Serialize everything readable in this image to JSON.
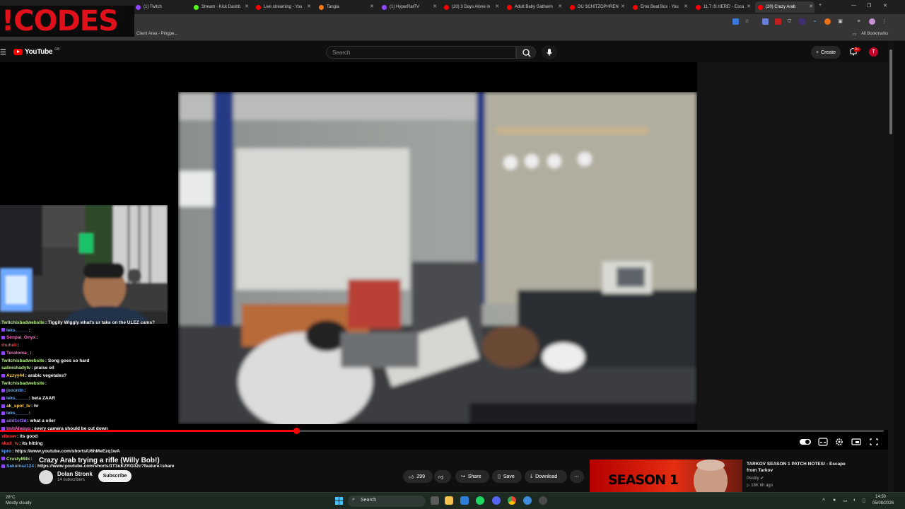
{
  "browser": {
    "tabs": [
      {
        "label": "(1) Twitch",
        "color": "#9147ff"
      },
      {
        "label": "Stream - Kick Dashb",
        "color": "#53fc18"
      },
      {
        "label": "Live streaming - You",
        "color": "#ff0000"
      },
      {
        "label": "Tangia",
        "color": "#ff7a1a"
      },
      {
        "label": "(1) HyperRatTV",
        "color": "#9147ff"
      },
      {
        "label": "(20) 3 Days Alone in",
        "color": "#ff0000"
      },
      {
        "label": "Adult Baby Gatherin",
        "color": "#ff0000"
      },
      {
        "label": "DU SCHITZOPHREN",
        "color": "#ff0000"
      },
      {
        "label": "Emo Beat Box - You",
        "color": "#ff0000"
      },
      {
        "label": "11.7 IS HERE! - Esca",
        "color": "#ff0000"
      },
      {
        "label": "(20) Crazy Arab",
        "color": "#ff0000"
      }
    ],
    "bookmark_client_area": "Client Area - Pingpe...",
    "bookmark_all": "All Bookmarks"
  },
  "overlay": {
    "logo_text": "!CODES"
  },
  "youtube": {
    "logo_text": "YouTube",
    "country_code": "GB",
    "search_placeholder": "Search",
    "create_label": "Create",
    "notification_count": "9+",
    "avatar_letter": "T"
  },
  "player": {
    "progress": 0.335
  },
  "chat": [
    {
      "user": "Twitchisbadwebsite",
      "user_color": "#b9f18a",
      "msg": ": Tiggily Wiggly what's ur take on the ULEZ cams?"
    },
    {
      "user": "leks_____",
      "user_color": "#5fb0ff",
      "msg": ":"
    },
    {
      "user": "Senpai_Onyx",
      "user_color": "#ff6ec7",
      "msg": ":"
    },
    {
      "user": "rhuheli",
      "user_color": "#ff4040",
      "msg": ":"
    },
    {
      "user": "Teratoma_",
      "user_color": "#ff6ec7",
      "msg": ":"
    },
    {
      "user": "Twitchisbadwebsite",
      "user_color": "#b9f18a",
      "msg": ": Song goes so hard"
    },
    {
      "user": "salimshadytv",
      "user_color": "#b9f18a",
      "msg": ": praise oil"
    },
    {
      "user": "Azzyy44",
      "user_color": "#ffd23f",
      "msg": ": arabic vegetales?"
    },
    {
      "user": "Twitchisbadwebsite",
      "user_color": "#b9f18a",
      "msg": ":"
    },
    {
      "user": "jooordn",
      "user_color": "#5fb0ff",
      "msg": ":"
    },
    {
      "user": "leks_____",
      "user_color": "#5fb0ff",
      "msg": ": beta ZAAR"
    },
    {
      "user": "ak_spot_tv",
      "user_color": "#ffd23f",
      "msg": ": hr"
    },
    {
      "user": "leks_____",
      "user_color": "#5fb0ff",
      "msg": ":"
    },
    {
      "user": "add1ct3d",
      "user_color": "#a070ff",
      "msg": ": what a oiler"
    },
    {
      "user": "tmhAlways",
      "user_color": "#ff6ec7",
      "msg": ": every camera should be cut down"
    },
    {
      "user": "xlbrow",
      "user_color": "#ff4040",
      "msg": ": its good"
    },
    {
      "user": "skull_tv",
      "user_color": "#ff4040",
      "msg": ": its hitting"
    },
    {
      "user": "kpro",
      "user_color": "#5fb0ff",
      "msg": ": https://www.youtube.com/shorts/U6hMeEzq1wA"
    },
    {
      "user": "CrustyMilk",
      "user_color": "#b9f18a",
      "msg": ":"
    },
    {
      "user": "Sakuinaz124",
      "user_color": "#5fb0ff",
      "msg": ": https://www.youtube.com/shorts/1T3uKZRG02c?feature=share"
    }
  ],
  "video": {
    "title": "Crazy Arab trying a rifle (Willy Bob!)",
    "channel": "Dolan Stronk",
    "subscribers": "14 subscribers",
    "subscribe_label": "Subscribe",
    "likes": "299",
    "share_label": "Share",
    "save_label": "Save",
    "download_label": "Download"
  },
  "recommendation": {
    "title": "TARKOV SEASON 1 PATCH NOTES! - Escape from Tarkov",
    "channel": "Pestily",
    "meta": "18K  6h ago",
    "thumb_text": "SEASON 1"
  },
  "taskbar": {
    "temp": "28°C",
    "weather": "Mostly cloudy",
    "search_label": "Search",
    "time": "14:50",
    "date": "05/08/2026"
  }
}
